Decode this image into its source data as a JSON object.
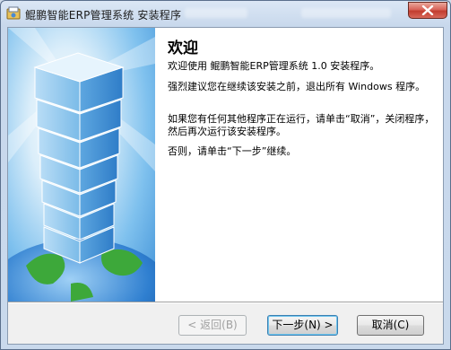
{
  "window": {
    "title": "鲲鹏智能ERP管理系统 安装程序",
    "icon": "installer-icon"
  },
  "welcome": {
    "heading": "欢迎",
    "p1": "欢迎使用 鲲鹏智能ERP管理系统 1.0 安装程序。",
    "p2": "强烈建议您在继续该安装之前，退出所有 Windows 程序。",
    "p3": "如果您有任何其他程序正在运行，请单击“取消”，关闭程序，然后再次运行该安装程序。",
    "p4": "否则，请单击“下一步”继续。"
  },
  "buttons": {
    "back": "< 返回(B)",
    "next": "下一步(N) >",
    "cancel": "取消(C)"
  },
  "colors": {
    "accent": "#3c7fb1",
    "close": "#c23d2f"
  }
}
